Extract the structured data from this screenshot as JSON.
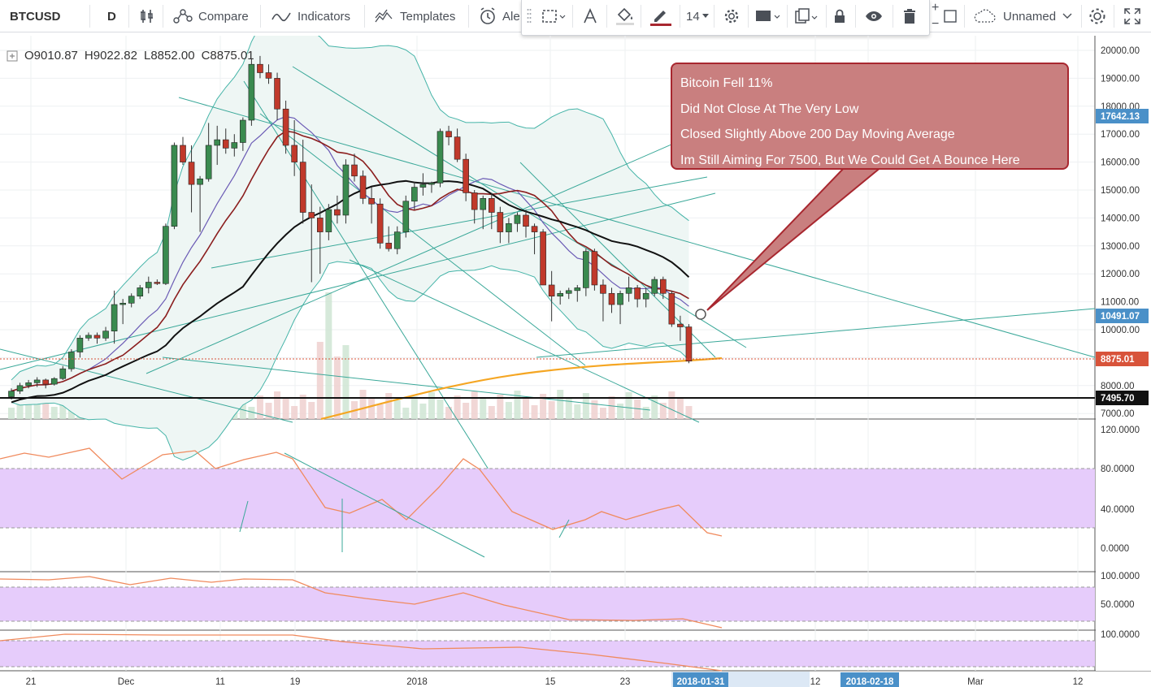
{
  "toolbar": {
    "symbol": "BTCUSD",
    "interval": "D",
    "compare_label": "Compare",
    "indicators_label": "Indicators",
    "templates_label": "Templates",
    "alert_label": "Ale",
    "layout_name": "Unnamed",
    "zoom_in": "+",
    "zoom_out": "−",
    "icons": [
      "bar-type-icon",
      "compare-icon",
      "indicators-icon",
      "templates-icon",
      "alert-icon",
      "cloud-icon",
      "gear-icon",
      "fullscreen-icon"
    ]
  },
  "drawing_toolbar": {
    "font_size": "14",
    "line_color": "#a8272f",
    "icons": [
      "select-area-icon",
      "text-icon",
      "fill-icon",
      "pencil-icon",
      "gear-icon",
      "rect-icon",
      "clone-icon",
      "lock-icon",
      "eye-icon",
      "trash-icon"
    ]
  },
  "legend": {
    "open_label": "O",
    "open": "9010.87",
    "high_label": "H",
    "high": "9022.82",
    "low_label": "L",
    "low": "8852.00",
    "close_label": "C",
    "close": "8875.01"
  },
  "annotation": {
    "lines": [
      "Bitcoin Fell 11%",
      "Did Not Close At The Very Low",
      "Closed Slightly Above 200 Day Moving Average",
      "Im Still Aiming For 7500, But We Could Get A Bounce Here"
    ]
  },
  "colors": {
    "up": "#3a8a4f",
    "down": "#c0392b",
    "band_fill": "#eef6f4",
    "rsi_band": "#e6ccfb",
    "ma200": "#f5a623",
    "price_tag": "#d8533a",
    "blue_tag": "#4a90c8"
  },
  "price_scale": {
    "ticks": [
      "20000.00",
      "19000.00",
      "18000.00",
      "17000.00",
      "16000.00",
      "15000.00",
      "14000.00",
      "13000.00",
      "12000.00",
      "11000.00",
      "10000.00",
      "8000.00",
      "7000.00"
    ],
    "tags": [
      {
        "value": "17642.13",
        "color": "#4a90c8"
      },
      {
        "value": "10491.07",
        "color": "#4a90c8"
      },
      {
        "value": "8875.01",
        "color": "#d8533a"
      },
      {
        "value": "7495.70",
        "color": "#111111"
      }
    ]
  },
  "osc1_scale": [
    "120.0000",
    "80.0000",
    "40.0000",
    "0.0000"
  ],
  "osc2_scale": [
    "100.0000",
    "50.0000"
  ],
  "osc3_scale": [
    "100.0000"
  ],
  "time_axis": {
    "labels": [
      "21",
      "Dec",
      "11",
      "19",
      "2018",
      "15",
      "23",
      "12",
      "Mar",
      "12"
    ],
    "highlights": [
      "2018-01-31",
      "2018-02-18"
    ]
  },
  "chart_data": {
    "type": "candlestick",
    "candles": [
      [
        7600,
        7900,
        7500,
        7800
      ],
      [
        7800,
        8100,
        7700,
        8000
      ],
      [
        8000,
        8200,
        7900,
        8100
      ],
      [
        8100,
        8300,
        7950,
        8200
      ],
      [
        8200,
        8250,
        7900,
        8050
      ],
      [
        8050,
        8300,
        8000,
        8250
      ],
      [
        8250,
        8700,
        8200,
        8600
      ],
      [
        8600,
        9300,
        8500,
        9200
      ],
      [
        9200,
        9800,
        9000,
        9700
      ],
      [
        9700,
        9900,
        9600,
        9800
      ],
      [
        9800,
        9900,
        9500,
        9700
      ],
      [
        9700,
        10100,
        9600,
        9950
      ],
      [
        9950,
        11400,
        9500,
        10900
      ],
      [
        10900,
        11100,
        10200,
        10950
      ],
      [
        10950,
        11300,
        10800,
        11200
      ],
      [
        11200,
        11600,
        11100,
        11500
      ],
      [
        11500,
        11900,
        11300,
        11700
      ],
      [
        11700,
        11800,
        11600,
        11650
      ],
      [
        11650,
        13800,
        11600,
        13700
      ],
      [
        13700,
        16700,
        13600,
        16600
      ],
      [
        16600,
        16900,
        15900,
        16000
      ],
      [
        16000,
        16600,
        14200,
        15200
      ],
      [
        15200,
        15500,
        13500,
        15400
      ],
      [
        15400,
        17400,
        15300,
        16600
      ],
      [
        16600,
        17300,
        15900,
        16800
      ],
      [
        16800,
        17200,
        16300,
        16500
      ],
      [
        16500,
        17000,
        16200,
        16700
      ],
      [
        16700,
        17600,
        16400,
        17500
      ],
      [
        17500,
        19700,
        17300,
        19500
      ],
      [
        19500,
        19800,
        19000,
        19200
      ],
      [
        19200,
        19500,
        18800,
        19000
      ],
      [
        19000,
        19200,
        17500,
        17900
      ],
      [
        17900,
        18200,
        16300,
        16600
      ],
      [
        16600,
        17500,
        15500,
        16000
      ],
      [
        16000,
        16800,
        13800,
        14200
      ],
      [
        14200,
        15200,
        11700,
        14000
      ],
      [
        14000,
        14400,
        12000,
        13500
      ],
      [
        13500,
        14500,
        13200,
        14300
      ],
      [
        14300,
        14800,
        13800,
        14100
      ],
      [
        14100,
        16100,
        13800,
        15900
      ],
      [
        15900,
        16300,
        15300,
        15500
      ],
      [
        15500,
        15700,
        14500,
        14700
      ],
      [
        14700,
        15100,
        13800,
        14500
      ],
      [
        14500,
        14700,
        12900,
        13100
      ],
      [
        13100,
        13700,
        12800,
        12900
      ],
      [
        12900,
        13700,
        12700,
        13500
      ],
      [
        13500,
        14800,
        13300,
        14600
      ],
      [
        14600,
        15300,
        14300,
        15100
      ],
      [
        15100,
        15600,
        14800,
        15200
      ],
      [
        15200,
        15300,
        14900,
        15250
      ],
      [
        15250,
        17200,
        15100,
        17100
      ],
      [
        17100,
        17300,
        16600,
        16900
      ],
      [
        16900,
        17200,
        16000,
        16100
      ],
      [
        16100,
        16300,
        14600,
        14900
      ],
      [
        14900,
        15000,
        13800,
        14300
      ],
      [
        14300,
        14800,
        13600,
        14700
      ],
      [
        14700,
        14900,
        13600,
        14200
      ],
      [
        14200,
        14400,
        13100,
        13500
      ],
      [
        13500,
        14000,
        13100,
        13800
      ],
      [
        13800,
        14200,
        13500,
        14100
      ],
      [
        14100,
        14300,
        13300,
        13700
      ],
      [
        13700,
        13800,
        12700,
        13500
      ],
      [
        13500,
        13600,
        11700,
        11600
      ],
      [
        11600,
        12100,
        10300,
        11200
      ],
      [
        11200,
        11400,
        10900,
        11300
      ],
      [
        11300,
        11500,
        11100,
        11400
      ],
      [
        11400,
        11600,
        11000,
        11500
      ],
      [
        11500,
        12900,
        11200,
        12800
      ],
      [
        12800,
        12900,
        11400,
        11600
      ],
      [
        11600,
        11800,
        10300,
        11300
      ],
      [
        11300,
        11500,
        10600,
        10900
      ],
      [
        10900,
        11400,
        10200,
        11300
      ],
      [
        11300,
        11900,
        11000,
        11500
      ],
      [
        11500,
        11600,
        10800,
        11100
      ],
      [
        11100,
        11500,
        10800,
        11300
      ],
      [
        11300,
        11900,
        11200,
        11800
      ],
      [
        11800,
        11900,
        11100,
        11300
      ],
      [
        11300,
        11400,
        10100,
        10200
      ],
      [
        10200,
        10500,
        9600,
        10100
      ],
      [
        10100,
        10200,
        8800,
        8875
      ]
    ]
  }
}
